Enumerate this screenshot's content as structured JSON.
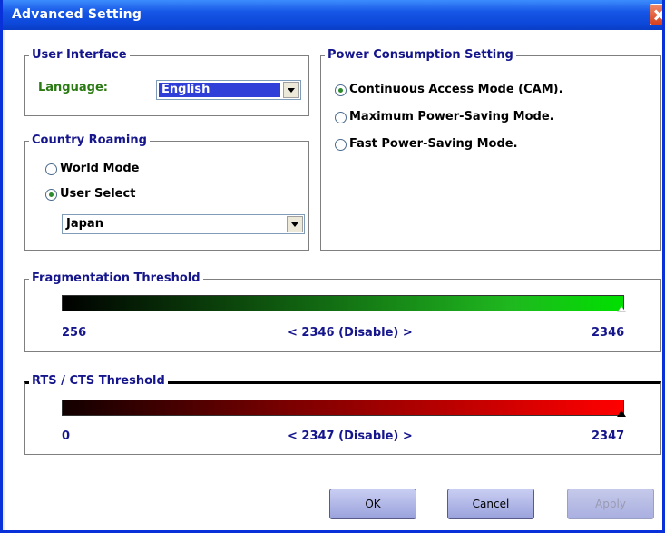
{
  "window": {
    "title": "Advanced Setting"
  },
  "user_interface": {
    "legend": "User Interface",
    "language_label": "Language:",
    "language_value": "English"
  },
  "power": {
    "legend": "Power Consumption Setting",
    "options": [
      {
        "label": "Continuous Access Mode (CAM).",
        "checked": true
      },
      {
        "label": "Maximum Power-Saving Mode.",
        "checked": false
      },
      {
        "label": "Fast Power-Saving Mode.",
        "checked": false
      }
    ]
  },
  "country": {
    "legend": "Country Roaming",
    "options": [
      {
        "label": "World Mode",
        "checked": false
      },
      {
        "label": "User Select",
        "checked": true
      }
    ],
    "country_value": "Japan"
  },
  "fragmentation": {
    "legend": "Fragmentation Threshold",
    "min": "256",
    "current": "< 2346 (Disable) >",
    "max": "2346",
    "level": 1.0
  },
  "rts": {
    "legend": "RTS / CTS Threshold",
    "min": "0",
    "current": "< 2347 (Disable) >",
    "max": "2347",
    "level": 1.0
  },
  "buttons": {
    "ok": "OK",
    "cancel": "Cancel",
    "apply": "Apply"
  }
}
